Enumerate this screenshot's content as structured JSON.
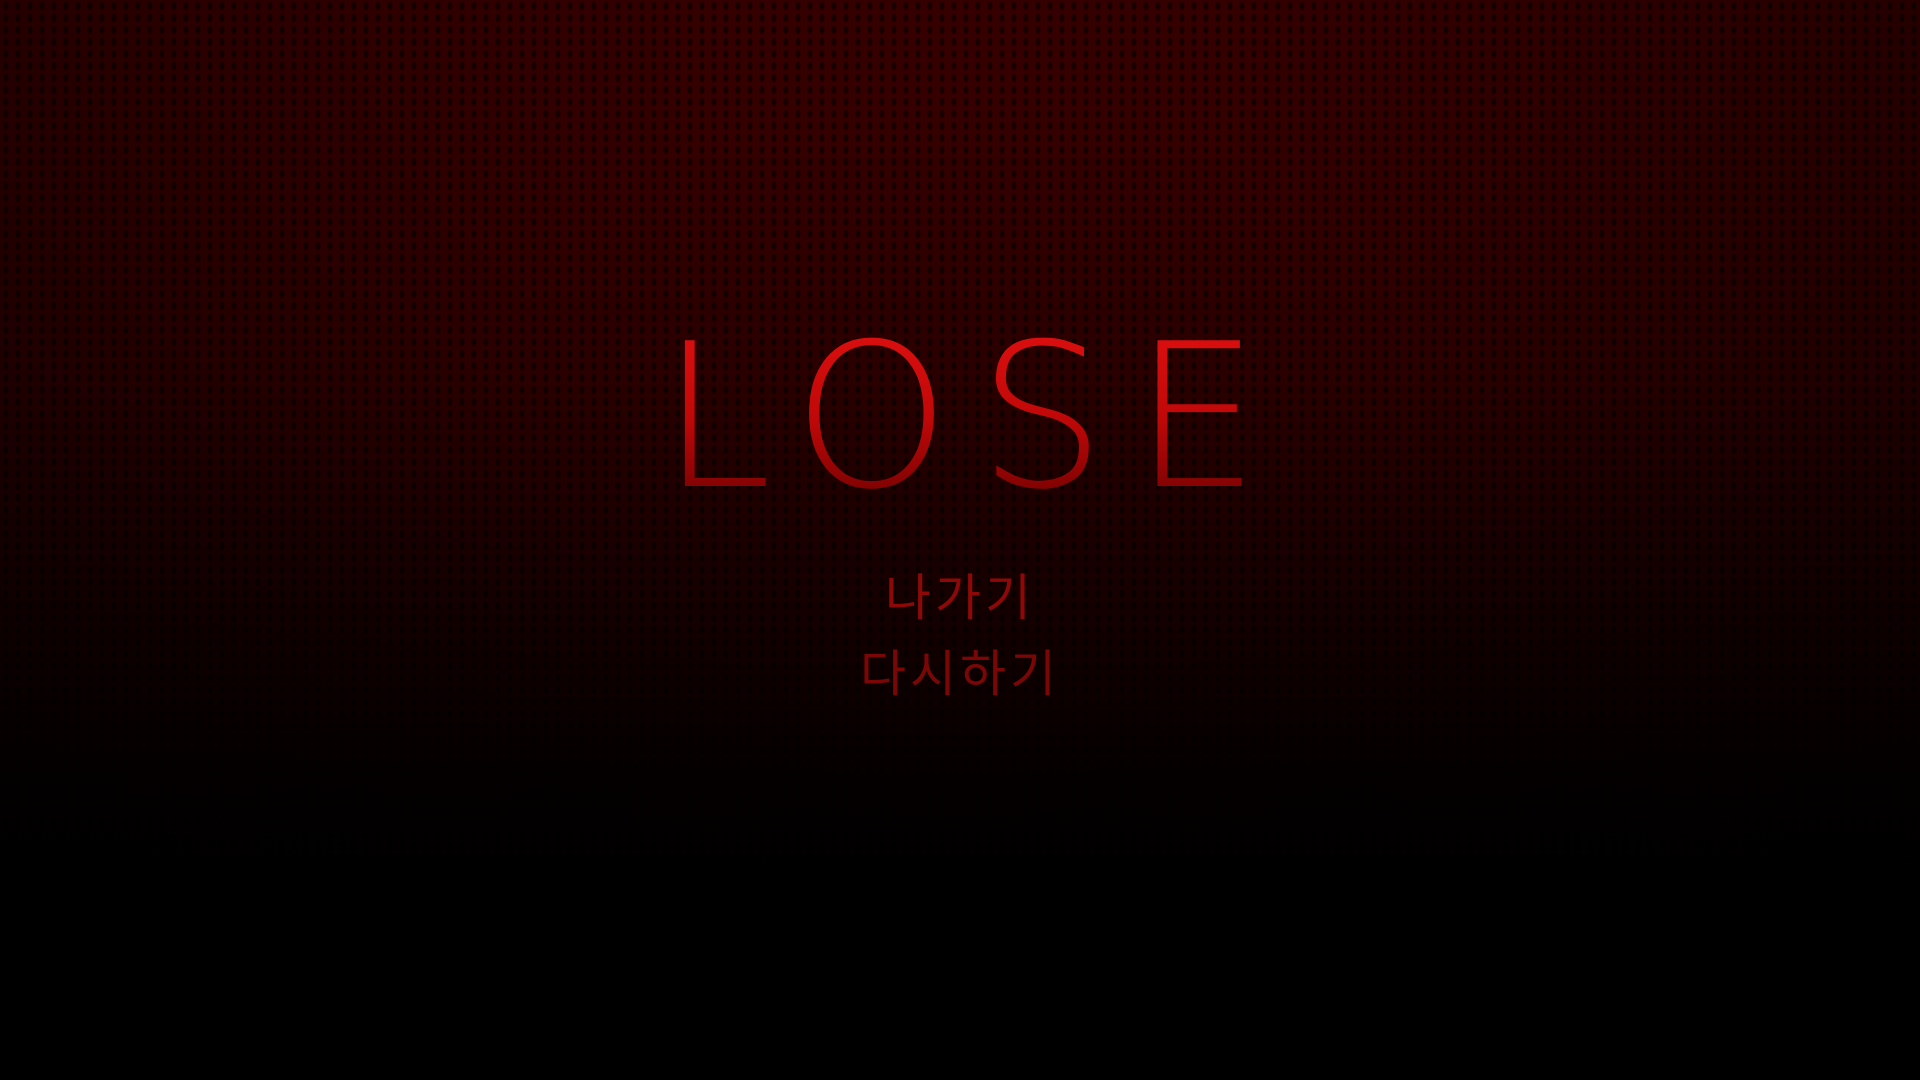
{
  "result": {
    "title": "LOSE"
  },
  "menu": {
    "exit_label": "나가기",
    "retry_label": "다시하기"
  },
  "colors": {
    "title_red": "#c40a0a",
    "menu_red": "#8e0808",
    "background_top": "#3a0000",
    "background_bottom": "#000000"
  }
}
